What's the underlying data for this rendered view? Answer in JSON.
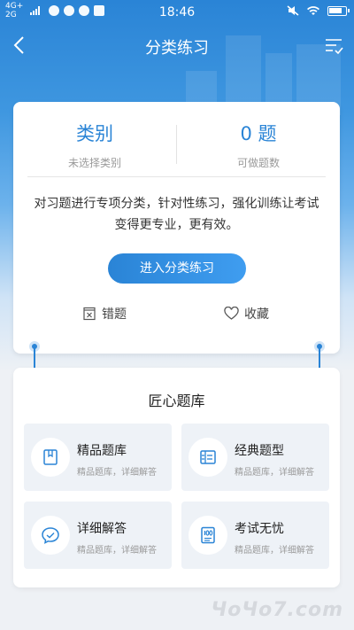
{
  "status_bar": {
    "network_top": "4G+",
    "network_bottom": "2G",
    "time": "18:46"
  },
  "nav": {
    "title": "分类练习",
    "back_icon": "chevron-left-icon",
    "menu_icon": "list-check-icon"
  },
  "summary": {
    "category_value": "类别",
    "category_label": "未选择类别",
    "count_value": "0 题",
    "count_label": "可做题数",
    "description": "对习题进行专项分类，针对性练习，强化训练让考试变得更专业，更有效。",
    "enter_button": "进入分类练习",
    "wrong_label": "错题",
    "favorite_label": "收藏"
  },
  "library": {
    "title": "匠心题库",
    "tiles": [
      {
        "title": "精品题库",
        "subtitle": "精品题库，详细解答",
        "icon": "book-icon"
      },
      {
        "title": "经典题型",
        "subtitle": "精品题库，详细解答",
        "icon": "list-icon"
      },
      {
        "title": "详细解答",
        "subtitle": "精品题库，详细解答",
        "icon": "chat-icon"
      },
      {
        "title": "考试无忧",
        "subtitle": "精品题库，详细解答",
        "icon": "score-sheet-icon"
      }
    ]
  },
  "colors": {
    "primary": "#2a84d6",
    "tile_bg": "#eef2f7"
  },
  "watermark": "ЧоЧо7.com"
}
